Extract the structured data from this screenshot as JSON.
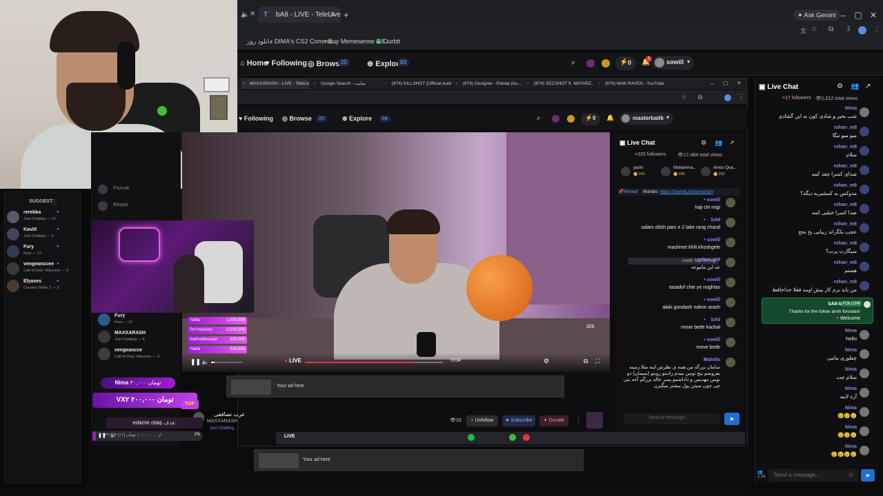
{
  "browser": {
    "tabs": [
      {
        "label": "bA8 - LIVE - TeleLive",
        "active": true
      }
    ],
    "ask_gemini": "Ask Gemini",
    "bookmarks": [
      "دانلود روز",
      "DIMA's CS2 Commu...",
      "Buy Memesense CS...",
      "Ourbit"
    ]
  },
  "site": {
    "nav": {
      "home": "Home",
      "following": "Following",
      "browse": "Browse",
      "browse_count": "20",
      "explore": "Explore",
      "explore_count": "83"
    },
    "user": "sowill",
    "bolts": "0",
    "notif_count": "1"
  },
  "suggest": {
    "title": "SUGGEST",
    "items": [
      {
        "name": "rerebka",
        "sub": "Just Chatting — 12"
      },
      {
        "name": "KavIX",
        "sub": "Just Chatting — 6"
      },
      {
        "name": "Fury",
        "sub": "Rust — 12"
      },
      {
        "name": "vengeanccee",
        "sub": "Call of Duty: Warzone — 3"
      },
      {
        "name": "Elyases",
        "sub": "Counter-Strike 2 — 2"
      }
    ]
  },
  "inner": {
    "tabs": [
      "MAXXARASH - LIVE - TeleLive",
      "Google Search - سایت",
      "(874) KILLSHOT [Official Audi...",
      "(874) Designer - Panda (Au...",
      "(874) SECSHOT ft. MATARZ...",
      "(874) MAK RAVEN - YouTube"
    ],
    "nav": {
      "following": "Following",
      "browse": "Browse",
      "browse_count": "20",
      "explore": "Explore",
      "explore_count": "84"
    },
    "user": "masterbaitk",
    "bolts": "0",
    "chat_title": "Live Chat",
    "followers": "335 followers",
    "views": "17,464 total views",
    "top": [
      {
        "name": "yasin",
        "amount": "300"
      },
      {
        "name": "Mohamma...",
        "amount": "300"
      },
      {
        "name": "Amoo Qua...",
        "amount": "250"
      }
    ],
    "pinned_label": "Pinned",
    "pinned_user": "Mahdis:",
    "pinned_link": "https://zeymtLit/maxxarash",
    "messages": [
      {
        "name": "sowill",
        "text": "haji chi migi"
      },
      {
        "name": "bA8",
        "text": "salam ddsh pars e 2 lake rang chand"
      },
      {
        "name": "sowill",
        "text": "mashinet khili khoshgele"
      },
      {
        "name": "rohan_m8",
        "text": "عه این ماموعه",
        "reply": "sowill: haji chi migi"
      },
      {
        "name": "sowill",
        "text": "tasadof chie ye noghtas"
      },
      {
        "name": "sowill",
        "text": "alaki gondash nakon arash"
      },
      {
        "name": "bA8",
        "text": "move bede kachal"
      },
      {
        "name": "sowill",
        "text": "move bede"
      },
      {
        "name": "Mahdis",
        "text": "سامان بزرگه من همه ی نظرش اینه مثلا زمینه بفروشم پنج تومن میدم زادیتو روبتو (سیمان) دو تومن مهدیس و داداشمو پسر خاله بزرگم آخه یتی چی چون سیتن پول بیشتر میگیرن"
      }
    ],
    "input_placeholder": "Send a message...",
    "player": {
      "live": "LIVE",
      "time": "-0:04",
      "donors": [
        {
          "name": "Yalda",
          "amount": "1,000,000"
        },
        {
          "name": "PeYmanfury",
          "amount": "1,000,000"
        },
        {
          "name": "NakhaMousavi",
          "amount": "500,000"
        },
        {
          "name": "Yalda",
          "amount": "500,000"
        }
      ],
      "viewers": "326"
    },
    "ad": "Your ad here",
    "streamer_name": "MAXXARASH",
    "stream_title": "غرب تصافقی",
    "stream_game": "Just Chatting",
    "viewer_count": "10",
    "unfollow": "Unfollow",
    "subscribe": "Subscribe",
    "donate": "Donate"
  },
  "overlay": {
    "stream_list": [
      {
        "name": "Fury",
        "sub": "Rust — 12"
      },
      {
        "name": "MAXXARASH",
        "sub": "Just Chatting — 8"
      },
      {
        "name": "vengeancce",
        "sub": "Call of Duty: Warzone — 3"
      }
    ],
    "donation1_name": "Nima",
    "donation1_amount": "۲۰,۰۰۰ تومان",
    "donation2_name": "VX۲",
    "donation2_amount": "۲۰۰,۰۰۰ تومان",
    "top_badge": "TOP",
    "goal_label": "هدف:",
    "goal_text": "edame otaq",
    "goal_progress": "۱۳۹,۹۵۴ از ۱۰,۰۰۰,۰۰۰ تومان (۱٪)",
    "goal_percent": "1%"
  },
  "outer_ad": "Your ad here",
  "right_chat": {
    "title": "Live Chat",
    "followers": "17 followers",
    "views": "1,012 total views",
    "messages": [
      {
        "name": "Nima",
        "text": "شب بخیر و شادی کون به این گشادی"
      },
      {
        "name": "rohan_m8",
        "text": "میو میو تیگا"
      },
      {
        "name": "rohan_m8",
        "text": "سلام"
      },
      {
        "name": "rohan_m8",
        "text": "صدای کسرا چقد کمه"
      },
      {
        "name": "rohan_m8",
        "text": "مدوکس به کمشیریه دیگه؟"
      },
      {
        "name": "rohan_m8",
        "text": "صدا کسرا خیلیی کمه"
      },
      {
        "name": "rohan_m8",
        "text": "عجب بکگراند زیبایی بخ بحح"
      },
      {
        "name": "rohan_m8",
        "text": "سیگارت پرت؟"
      },
      {
        "name": "rohan_m8",
        "text": "هستم"
      },
      {
        "name": "rohan_m8",
        "text": "من باید برم کار پیش اومد فعلا خداحافظ"
      }
    ],
    "bot": {
      "name": "bA8-bot",
      "badge": "FOLLOW",
      "text": "Thanks for the follow arvin foroutan!",
      "welcome": "Welcome"
    },
    "later": [
      {
        "name": "Nima",
        "text": "hello"
      },
      {
        "name": "Nima",
        "text": "چطوری ماتیی"
      },
      {
        "name": "Nima",
        "text": "سلام چت"
      },
      {
        "name": "Nima",
        "text": "آره لابیه"
      },
      {
        "name": "Nima",
        "text": "😢😢😢"
      },
      {
        "name": "Nima",
        "text": "😢😢😢"
      },
      {
        "name": "Nima",
        "text": "😢😢😢😢"
      }
    ],
    "input_placeholder": "Send a message...",
    "viewer_mini": "1.1k"
  },
  "colors": {
    "accent": "#7b61ff",
    "live": "#e5343f",
    "bolt": "#2d6cf6",
    "chat_name": "#8f7cff",
    "bot_bg": "#15492b",
    "donation": "#a01bd6"
  }
}
